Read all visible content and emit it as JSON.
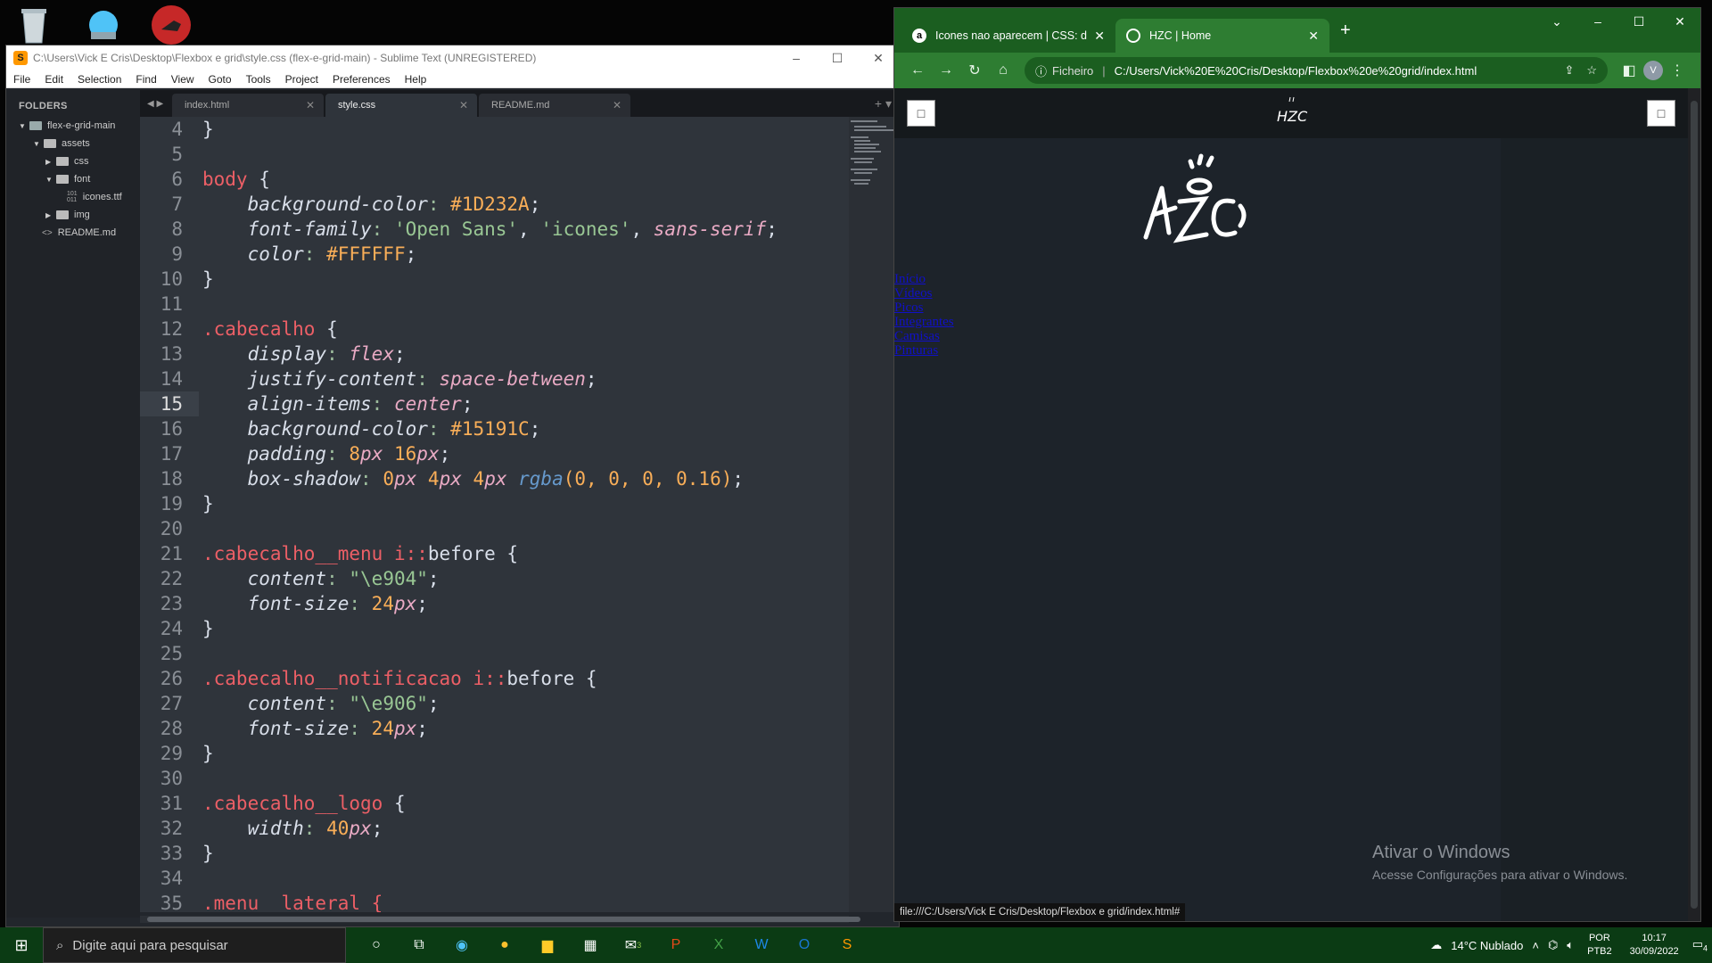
{
  "desktop": {
    "icons": [
      "recycle-bin-icon",
      "network-icon",
      "app-icon"
    ]
  },
  "sublime": {
    "title": "C:\\Users\\Vick E Cris\\Desktop\\Flexbox e grid\\style.css (flex-e-grid-main) - Sublime Text (UNREGISTERED)",
    "menu": [
      "File",
      "Edit",
      "Selection",
      "Find",
      "View",
      "Goto",
      "Tools",
      "Project",
      "Preferences",
      "Help"
    ],
    "sidebar": {
      "header": "FOLDERS",
      "items": [
        "flex-e-grid-main",
        "assets",
        "css",
        "font",
        "icones.ttf",
        "img",
        "README.md"
      ]
    },
    "tabs": [
      "index.html",
      "style.css",
      "README.md"
    ],
    "line_numbers": [
      "4",
      "5",
      "6",
      "7",
      "8",
      "9",
      "10",
      "11",
      "12",
      "13",
      "14",
      "15",
      "16",
      "17",
      "18",
      "19",
      "20",
      "21",
      "22",
      "23",
      "24",
      "25",
      "26",
      "27",
      "28",
      "29",
      "30",
      "31",
      "32",
      "33",
      "34",
      "35"
    ],
    "current_line": "15",
    "code": {
      "l4": "}",
      "l6_sel": "body",
      "l6_rest": " {",
      "l7_prop": "background-color",
      "l7_val": "#1D232A",
      "l8_prop": "font-family",
      "l8_v1": "'Open Sans'",
      "l8_v2": "'icones'",
      "l8_v3": "sans-serif",
      "l9_prop": "color",
      "l9_val": "#FFFFFF",
      "l10": "}",
      "l12_sel": ".cabecalho",
      "l12_rest": " {",
      "l13_prop": "display",
      "l13_val": "flex",
      "l14_prop": "justify-content",
      "l14_val": "space-between",
      "l15_prop": "align-items",
      "l15_val": "center",
      "l16_prop": "background-color",
      "l16_val": "#15191C",
      "l17_prop": "padding",
      "l17_n1": "8",
      "l17_u1": "px",
      "l17_n2": "16",
      "l17_u2": "px",
      "l18_prop": "box-shadow",
      "l18_n1": "0",
      "l18_u1": "px",
      "l18_n2": "4",
      "l18_u2": "px",
      "l18_n3": "4",
      "l18_u3": "px",
      "l18_fn": "rgba",
      "l18_args": "(0, 0, 0, 0.16)",
      "l19": "}",
      "l21_sel": ".cabecalho__menu",
      "l21_i": " i",
      "l21_pseudo": "::",
      "l21_before": "before",
      "l21_rest": " {",
      "l22_prop": "content",
      "l22_val": "\"\\e904\"",
      "l23_prop": "font-size",
      "l23_n": "24",
      "l23_u": "px",
      "l24": "}",
      "l26_sel": ".cabecalho__notificacao",
      "l26_i": " i",
      "l26_pseudo": "::",
      "l26_before": "before",
      "l26_rest": " {",
      "l27_prop": "content",
      "l27_val": "\"\\e906\"",
      "l28_prop": "font-size",
      "l28_n": "24",
      "l28_u": "px",
      "l29": "}",
      "l31_sel": ".cabecalho__logo",
      "l31_rest": " {",
      "l32_prop": "width",
      "l32_n": "40",
      "l32_u": "px",
      "l33": "}",
      "l35": ".menu__lateral {"
    }
  },
  "chrome": {
    "tabs": [
      {
        "favicon": "a",
        "title": "Icones nao aparecem | CSS: disp"
      },
      {
        "favicon": "globe",
        "title": "HZC | Home"
      }
    ],
    "address_label": "Ficheiro",
    "url": "C:/Users/Vick%20E%20Cris/Desktop/Flexbox%20e%20grid/index.html",
    "avatar": "V",
    "page": {
      "menu_links": [
        "Início",
        "Vídeos",
        "Picos",
        "Integrantes",
        "Camisas",
        "Pinturas"
      ],
      "header_menu_icon": "□",
      "header_notification_icon": "□",
      "watermark_title": "Ativar o Windows",
      "watermark_text": "Acesse Configurações para ativar o Windows.",
      "status_url": "file:///C:/Users/Vick E Cris/Desktop/Flexbox e grid/index.html#"
    }
  },
  "taskbar": {
    "search_placeholder": "Digite aqui para pesquisar",
    "weather": "14°C  Nublado",
    "lang1": "POR",
    "lang2": "PTB2",
    "time": "10:17",
    "date": "30/09/2022",
    "notifications": "4",
    "outlook_badge": "3"
  }
}
